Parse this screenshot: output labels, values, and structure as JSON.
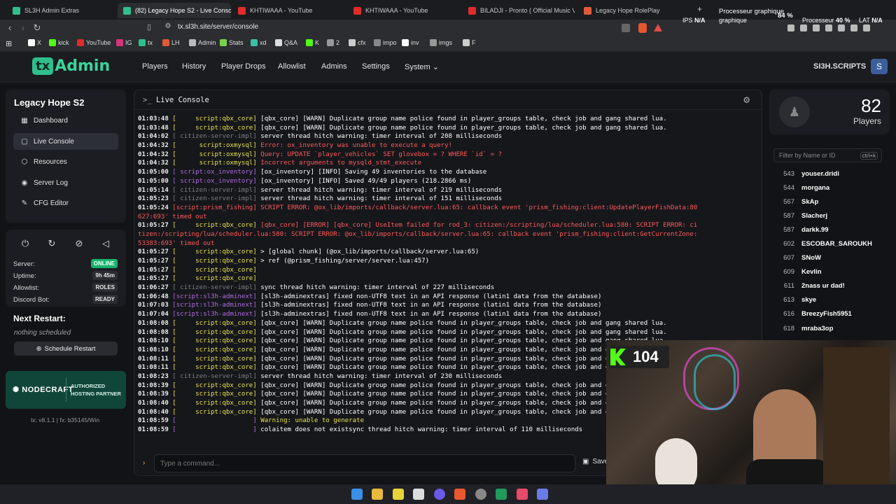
{
  "browser": {
    "tabs": [
      {
        "title": "SL3H Admin Extras",
        "color": "#2fbf8c"
      },
      {
        "title": "(82) Legacy Hope S2 - Live Console",
        "color": "#2fbf8c"
      },
      {
        "title": "KHTIWAAA - YouTube",
        "color": "#e02b2b"
      },
      {
        "title": "KHTIWAAA - YouTube",
        "color": "#e02b2b"
      },
      {
        "title": "BILADJI - Pronto ( Official Music Video )",
        "color": "#e02b2b"
      },
      {
        "title": "Legacy Hope RolePlay",
        "color": "#e05a3a"
      }
    ],
    "tab_close": "×",
    "new_tab": "+",
    "url": "tx.sl3h.site/server/console",
    "bookmarks": [
      {
        "label": "X",
        "color": "#ffffff"
      },
      {
        "label": "kick",
        "color": "#53fc18"
      },
      {
        "label": "YouTube",
        "color": "#e02b2b"
      },
      {
        "label": "IG",
        "color": "#d6337a"
      },
      {
        "label": "tx",
        "color": "#2fbf8c"
      },
      {
        "label": "LH",
        "color": "#e05a3a"
      },
      {
        "label": "Admin",
        "color": "#bbbbbb"
      },
      {
        "label": "Stats",
        "color": "#7ad04a"
      },
      {
        "label": "xd",
        "color": "#3ac0a0"
      },
      {
        "label": "Q&A",
        "color": "#dddddd"
      },
      {
        "label": "K",
        "color": "#53fc18"
      },
      {
        "label": "2",
        "color": "#999999"
      },
      {
        "label": "cfx",
        "color": "#cccccc"
      },
      {
        "label": "impo",
        "color": "#888888"
      },
      {
        "label": "inv",
        "color": "#ffffff"
      },
      {
        "label": "imgs",
        "color": "#999999"
      },
      {
        "label": "F",
        "color": "#cccccc"
      }
    ],
    "sys": {
      "ips_label": "IPS",
      "ips_val": "N/A",
      "proc_label": "Processeur graphique",
      "proc_val": "84 %",
      "cpu_label": "Processeur",
      "cpu_val": "40 %",
      "lat_label": "LAT",
      "lat_val": "N/A"
    }
  },
  "header": {
    "logo_tx": "tx",
    "logo_admin": "Admin",
    "nav": [
      "Players",
      "History",
      "Player Drops",
      "Allowlist",
      "Admins",
      "Settings",
      "System ⌄"
    ],
    "user": "SI3H.SCRIPTS"
  },
  "sidebar": {
    "server_name": "Legacy Hope S2",
    "items": [
      {
        "label": "Dashboard",
        "icon": "▦"
      },
      {
        "label": "Live Console",
        "icon": "▢"
      },
      {
        "label": "Resources",
        "icon": "⬡"
      },
      {
        "label": "Server Log",
        "icon": "◉"
      },
      {
        "label": "CFG Editor",
        "icon": "✎"
      }
    ]
  },
  "status": {
    "icons": [
      "⏻",
      "↻",
      "⊘",
      "◁"
    ],
    "server_label": "Server:",
    "server_val": "ONLINE",
    "uptime_label": "Uptime:",
    "uptime_val": "9h 45m",
    "allowlist_label": "Allowlist:",
    "allowlist_val": "ROLES",
    "discord_label": "Discord Bot:",
    "discord_val": "READY"
  },
  "next_restart": {
    "title": "Next Restart:",
    "none": "nothing scheduled",
    "button": "Schedule Restart"
  },
  "partner": {
    "name": "NODECRAFT",
    "tag1": "AUTHORIZED",
    "tag2": "HOSTING PARTNER"
  },
  "version": "tx: v8.1.1 | fx: b35145/Win",
  "console": {
    "title": "Live Console",
    "placeholder": "Type a command...",
    "save": "Save",
    "lines": [
      {
        "t": "01:03:48",
        "s": "[     script:qbx_core]",
        "sc": "y",
        "m": " [qbx_core] [WARN] Duplicate group name police found in player_groups table, check job and gang shared lua.",
        "mc": "w"
      },
      {
        "t": "01:03:48",
        "s": "[     script:qbx_core]",
        "sc": "y",
        "m": " [qbx_core] [WARN] Duplicate group name police found in player_groups table, check job and gang shared lua.",
        "mc": "w"
      },
      {
        "t": "01:04:02",
        "s": "[ citizen-server-impl]",
        "sc": "g",
        "m": " server thread hitch warning: timer interval of 208 milliseconds",
        "mc": "w"
      },
      {
        "t": "01:04:32",
        "s": "[      script:oxmysql]",
        "sc": "y",
        "m": " Error: ox_inventory was unable to execute a query!",
        "mc": "r"
      },
      {
        "t": "01:04:32",
        "s": "[      script:oxmysql]",
        "sc": "y",
        "m": " Query: UPDATE `player_vehicles` SET glovebox = ? WHERE `id` = ?",
        "mc": "r"
      },
      {
        "t": "01:04:32",
        "s": "[      script:oxmysql]",
        "sc": "y",
        "m": " Incorrect arguments to mysqld_stmt_execute",
        "mc": "r"
      },
      {
        "t": "01:05:00",
        "s": "[ script:ox_inventory]",
        "sc": "p",
        "m": " [ox_inventory] [INFO] Saving 49 inventories to the database",
        "mc": "w"
      },
      {
        "t": "01:05:00",
        "s": "[ script:ox_inventory]",
        "sc": "p",
        "m": " [ox_inventory] [INFO] Saved 49/49 players (218.2866 ms)",
        "mc": "w"
      },
      {
        "t": "01:05:14",
        "s": "[ citizen-server-impl]",
        "sc": "g",
        "m": " server thread hitch warning: timer interval of 219 milliseconds",
        "mc": "w"
      },
      {
        "t": "01:05:23",
        "s": "[ citizen-server-impl]",
        "sc": "g",
        "m": " server thread hitch warning: timer interval of 151 milliseconds",
        "mc": "w"
      },
      {
        "t": "01:05:24",
        "s": "[script:prism_fishing]",
        "sc": "r",
        "m": " SCRIPT ERROR: @ox_lib/imports/callback/server.lua:65: callback event 'prism_fishing:client:UpdatePlayerFishData:80",
        "mc": "r"
      },
      {
        "t": "",
        "s": "",
        "sc": "r",
        "m": "627:693' timed out",
        "mc": "r"
      },
      {
        "t": "01:05:27",
        "s": "[     script:qbx_core]",
        "sc": "y",
        "m": " [qbx_core] [ERROR] [qbx_core] UseItem failed for rod_3: citizen:/scripting/lua/scheduler.lua:580: SCRIPT ERROR: ci",
        "mc": "r"
      },
      {
        "t": "",
        "s": "",
        "sc": "r",
        "m": "tizen:/scripting/lua/scheduler.lua:580: SCRIPT ERROR: @ox_lib/imports/callback/server.lua:65: callback event 'prism_fishing:client:GetCurrentZone:",
        "mc": "r"
      },
      {
        "t": "",
        "s": "",
        "sc": "r",
        "m": "53383:693' timed out",
        "mc": "r"
      },
      {
        "t": "01:05:27",
        "s": "[     script:qbx_core]",
        "sc": "y",
        "m": " > [global chunk] (@ox_lib/imports/callback/server.lua:65)",
        "mc": "w"
      },
      {
        "t": "01:05:27",
        "s": "[     script:qbx_core]",
        "sc": "y",
        "m": " > ref (@prism_fishing/server/server.lua:457)",
        "mc": "w"
      },
      {
        "t": "01:05:27",
        "s": "[     script:qbx_core]",
        "sc": "y",
        "m": "",
        "mc": "w"
      },
      {
        "t": "01:05:27",
        "s": "[     script:qbx_core]",
        "sc": "y",
        "m": "",
        "mc": "w"
      },
      {
        "t": "01:06:27",
        "s": "[ citizen-server-impl]",
        "sc": "g",
        "m": " sync thread hitch warning: timer interval of 227 milliseconds",
        "mc": "w"
      },
      {
        "t": "01:06:48",
        "s": "[script:sl3h-adminext]",
        "sc": "p",
        "m": " [sl3h-adminextras] fixed non-UTF8 text in an API response (latin1 data from the database)",
        "mc": "w"
      },
      {
        "t": "01:07:03",
        "s": "[script:sl3h-adminext]",
        "sc": "p",
        "m": " [sl3h-adminextras] fixed non-UTF8 text in an API response (latin1 data from the database)",
        "mc": "w"
      },
      {
        "t": "01:07:04",
        "s": "[script:sl3h-adminext]",
        "sc": "p",
        "m": " [sl3h-adminextras] fixed non-UTF8 text in an API response (latin1 data from the database)",
        "mc": "w"
      },
      {
        "t": "01:08:08",
        "s": "[     script:qbx_core]",
        "sc": "y",
        "m": " [qbx_core] [WARN] Duplicate group name police found in player_groups table, check job and gang shared lua.",
        "mc": "w"
      },
      {
        "t": "01:08:08",
        "s": "[     script:qbx_core]",
        "sc": "y",
        "m": " [qbx_core] [WARN] Duplicate group name police found in player_groups table, check job and gang shared lua.",
        "mc": "w"
      },
      {
        "t": "01:08:10",
        "s": "[     script:qbx_core]",
        "sc": "y",
        "m": " [qbx_core] [WARN] Duplicate group name police found in player_groups table, check job and gang shared lua.",
        "mc": "w"
      },
      {
        "t": "01:08:10",
        "s": "[     script:qbx_core]",
        "sc": "y",
        "m": " [qbx_core] [WARN] Duplicate group name police found in player_groups table, check job and gang shared lua.",
        "mc": "w"
      },
      {
        "t": "01:08:11",
        "s": "[     script:qbx_core]",
        "sc": "y",
        "m": " [qbx_core] [WARN] Duplicate group name police found in player_groups table, check job and gang shared lua.",
        "mc": "w"
      },
      {
        "t": "01:08:11",
        "s": "[     script:qbx_core]",
        "sc": "y",
        "m": " [qbx_core] [WARN] Duplicate group name police found in player_groups table, check job and gang shared lua.",
        "mc": "w"
      },
      {
        "t": "01:08:23",
        "s": "[ citizen-server-impl]",
        "sc": "g",
        "m": " server thread hitch warning: timer interval of 230 milliseconds",
        "mc": "w"
      },
      {
        "t": "01:08:39",
        "s": "[     script:qbx_core]",
        "sc": "y",
        "m": " [qbx_core] [WARN] Duplicate group name police found in player_groups table, check job and gang shared lua.",
        "mc": "w"
      },
      {
        "t": "01:08:39",
        "s": "[     script:qbx_core]",
        "sc": "y",
        "m": " [qbx_core] [WARN] Duplicate group name police found in player_groups table, check job and gang shared lua.",
        "mc": "w"
      },
      {
        "t": "01:08:40",
        "s": "[     script:qbx_core]",
        "sc": "y",
        "m": " [qbx_core] [WARN] Duplicate group name police found in player_groups table, check job and gang shared lua.",
        "mc": "w"
      },
      {
        "t": "01:08:40",
        "s": "[     script:qbx_core]",
        "sc": "y",
        "m": " [qbx_core] [WARN] Duplicate group name police found in player_groups table, check job and gang shared lua.",
        "mc": "w"
      },
      {
        "t": "01:08:59",
        "s": "[                    ]",
        "sc": "p",
        "m": " Warning: unable to generate",
        "mc": "y"
      },
      {
        "t": "01:08:59",
        "s": "[                    ]",
        "sc": "p",
        "m": " colaitem does not existsync thread hitch warning: timer interval of 110 milliseconds",
        "mc": "w"
      }
    ]
  },
  "players": {
    "count": "82",
    "label": "Players",
    "filter_placeholder": "Filter by Name or ID",
    "filter_kbd": "ctrl+k",
    "list": [
      {
        "id": "543",
        "name": "youser.dridi"
      },
      {
        "id": "544",
        "name": "morgana"
      },
      {
        "id": "567",
        "name": "SkAp"
      },
      {
        "id": "587",
        "name": "Slacherj"
      },
      {
        "id": "587",
        "name": "darkk.99"
      },
      {
        "id": "602",
        "name": "ESCOBAR_SAROUKH"
      },
      {
        "id": "607",
        "name": "SNoW"
      },
      {
        "id": "609",
        "name": "Kevlin"
      },
      {
        "id": "611",
        "name": "2nass ur dad!"
      },
      {
        "id": "613",
        "name": "skye"
      },
      {
        "id": "616",
        "name": "BreezyFish5951"
      },
      {
        "id": "618",
        "name": "mraba3op"
      }
    ]
  },
  "stream": {
    "kick_count": "104"
  }
}
